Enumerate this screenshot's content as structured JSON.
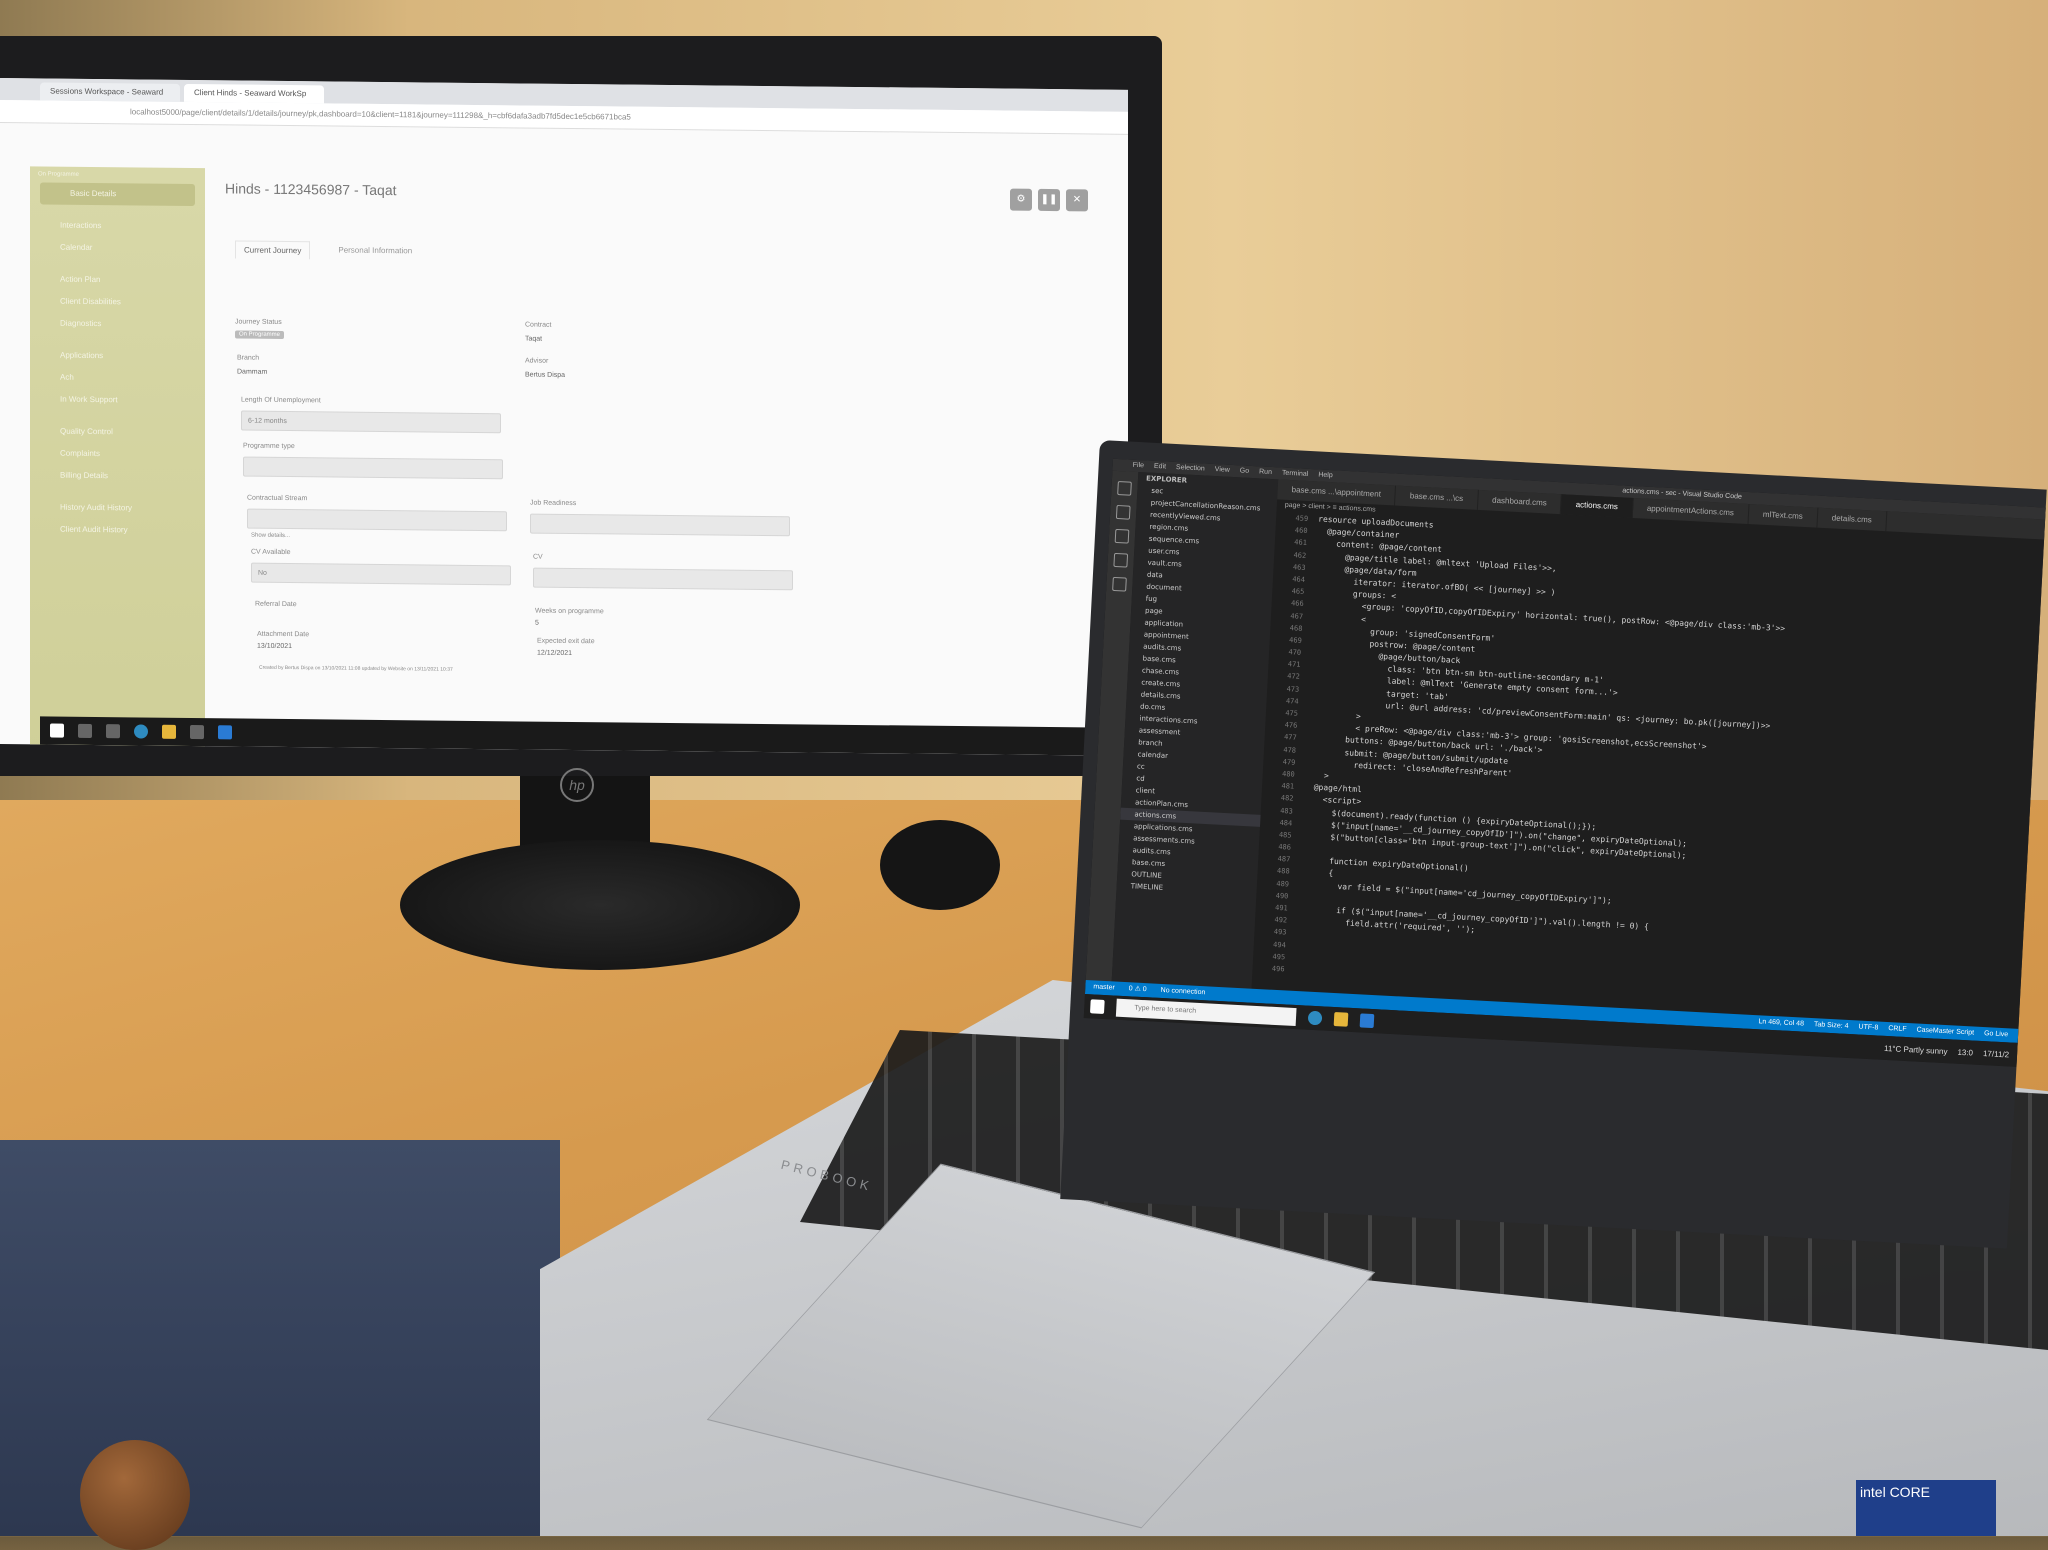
{
  "monitor": {
    "tabs": [
      "Sessions Workspace - Seaward",
      "Client Hinds - Seaward WorkSp"
    ],
    "address": "localhost5000/page/client/details/1/details/journey/pk,dashboard=10&client=1181&journey=111298&_h=cbf6dafa3adb7fd5dec1e5cb6671bca5",
    "sidebar": {
      "header": "On Programme",
      "items": [
        "Basic Details",
        "Interactions",
        "Calendar",
        "Action Plan",
        "Client Disabilities",
        "Diagnostics",
        "Applications",
        "Ach",
        "In Work Support",
        "Quality Control",
        "Complaints",
        "Billing Details",
        "History Audit History",
        "Client Audit History"
      ]
    },
    "page_title": "Hinds - 1123456987 - Taqat",
    "subtabs": [
      "Current Journey",
      "Personal Information"
    ],
    "fields": {
      "journey_status_label": "Journey Status",
      "journey_status_value": "On Programme",
      "contract_label": "Contract",
      "contract_value": "Taqat",
      "branch_label": "Branch",
      "branch_value": "Dammam",
      "advisor_label": "Advisor",
      "advisor_value": "Bertus Dispa",
      "length_label": "Length Of Unemployment",
      "length_value": "6-12 months",
      "programme_label": "Programme type",
      "stream_label": "Contractual Stream",
      "readiness_label": "Job Readiness",
      "show_details": "Show details...",
      "cv_available_label": "CV Available",
      "cv_available_value": "No",
      "cv_label": "CV",
      "referral_label": "Referral Date",
      "weeks_label": "Weeks on programme",
      "weeks_value": "5",
      "attachment_label": "Attachment Date",
      "attachment_value": "13/10/2021",
      "exit_label": "Expected exit date",
      "exit_value": "12/12/2021",
      "footer": "Created by Bertus Dispa on 13/10/2021 11:08 updated by Website on 13/11/2021 10:37"
    }
  },
  "laptop": {
    "title_menu": [
      "File",
      "Edit",
      "Selection",
      "View",
      "Go",
      "Run",
      "Terminal",
      "Help"
    ],
    "window_title": "actions.cms - sec - Visual Studio Code",
    "explorer_header": "EXPLORER",
    "explorer": [
      "sec",
      "projectCancellationReason.cms",
      "recentlyViewed.cms",
      "region.cms",
      "sequence.cms",
      "user.cms",
      "vault.cms",
      "data",
      "document",
      "fug",
      "page",
      "application",
      "appointment",
      "audits.cms",
      "base.cms",
      "chase.cms",
      "create.cms",
      "details.cms",
      "do.cms",
      "interactions.cms",
      "assessment",
      "branch",
      "calendar",
      "cc",
      "cd",
      "client",
      "actionPlan.cms",
      "actions.cms",
      "applications.cms",
      "assessments.cms",
      "audits.cms",
      "base.cms",
      "OUTLINE",
      "TIMELINE"
    ],
    "tabs": [
      "base.cms ...\\appointment",
      "base.cms ...\\cs",
      "dashboard.cms",
      "actions.cms",
      "appointmentActions.cms",
      "mlText.cms",
      "details.cms"
    ],
    "breadcrumb": "page > client > ≡ actions.cms",
    "line_numbers": [
      "459",
      "460",
      "461",
      "462",
      "463",
      "464",
      "465",
      "466",
      "467",
      "468",
      "469",
      "470",
      "471",
      "472",
      "473",
      "474",
      "475",
      "476",
      "477",
      "478",
      "479",
      "480",
      "481",
      "482",
      "483",
      "484",
      "485",
      "486",
      "487",
      "488",
      "489",
      "490",
      "491",
      "492",
      "493",
      "494",
      "495",
      "496"
    ],
    "code": [
      "resource uploadDocuments",
      "  @page/container",
      "    content: @page/content",
      "      @page/title label: @mltext 'Upload Files'>>,",
      "      @page/data/form",
      "        iterator: iterator.ofBO( << [journey] >> )",
      "        groups: <",
      "          <group: 'copyOfID,copyOfIDExpiry' horizontal: true(), postRow: <@page/div class:'mb-3'>>",
      "          <",
      "            group: 'signedConsentForm'",
      "            postrow: @page/content",
      "              @page/button/back",
      "                class: 'btn btn-sm btn-outline-secondary m-1'",
      "                label: @mlText 'Generate empty consent form...'>",
      "                target: 'tab'",
      "                url: @url address: 'cd/previewConsentForm:main' qs: <journey: bo.pk([journey])>>",
      "          >",
      "          < preRow: <@page/div class:'mb-3'> group: 'gosiScreenshot,ecsScreenshot'>",
      "        buttons: @page/button/back url: './back'>",
      "        submit: @page/button/submit/update",
      "          redirect: 'closeAndRefreshParent'",
      "    >",
      "  @page/html",
      "    <script>",
      "      $(document).ready(function () {expiryDateOptional();});",
      "      $(\"input[name='__cd_journey_copyOfID']\").on(\"change\", expiryDateOptional);",
      "      $(\"button[class='btn input-group-text']\").on(\"click\", expiryDateOptional);",
      "",
      "      function expiryDateOptional()",
      "      {",
      "        var field = $(\"input[name='cd_journey_copyOfIDExpiry']\");",
      "",
      "        if ($(\"input[name='__cd_journey_copyOfID']\").val().length != 0) {",
      "          field.attr('required', '');"
    ],
    "status_left": [
      "master",
      "0 ⚠ 0",
      "No connection"
    ],
    "status_right": [
      "Ln 469, Col 48",
      "Tab Size: 4",
      "UTF-8",
      "CRLF",
      "CaseMaster Script",
      "Go Live"
    ],
    "search_placeholder": "Type here to search",
    "weather": "11°C Partly sunny",
    "clock": "13:0",
    "date": "17/11/2",
    "brand": "PROBOOK",
    "intel": "intel CORE"
  }
}
